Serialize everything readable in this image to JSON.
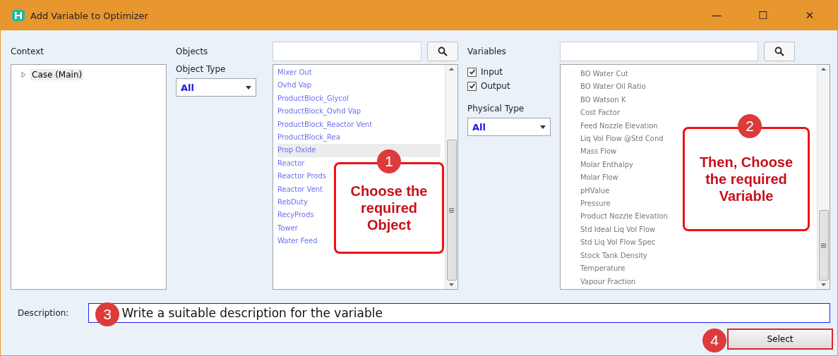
{
  "window": {
    "title": "Add Variable to Optimizer",
    "controls": [
      "—",
      "☐",
      "✕"
    ]
  },
  "context": {
    "label": "Context",
    "tree": [
      {
        "label": "Case (Main)",
        "expanded": false,
        "selected": true
      }
    ]
  },
  "objects": {
    "label": "Objects",
    "object_type": {
      "label": "Object Type",
      "value": "All"
    },
    "items": [
      {
        "label": "Mixer Out",
        "selected": false
      },
      {
        "label": "Ovhd Vap",
        "selected": false
      },
      {
        "label": "ProductBlock_Glycol",
        "selected": false
      },
      {
        "label": "ProductBlock_Ovhd Vap",
        "selected": false
      },
      {
        "label": "ProductBlock_Reactor Vent",
        "selected": false
      },
      {
        "label": "ProductBlock_Rea",
        "selected": false
      },
      {
        "label": "Prop Oxide",
        "selected": true
      },
      {
        "label": "Reactor",
        "selected": false
      },
      {
        "label": "Reactor Prods",
        "selected": false
      },
      {
        "label": "Reactor Vent",
        "selected": false
      },
      {
        "label": "RebDuty",
        "selected": false
      },
      {
        "label": "RecyProds",
        "selected": false
      },
      {
        "label": "Tower",
        "selected": false
      },
      {
        "label": "Water Feed",
        "selected": false
      }
    ]
  },
  "filters": {
    "checkboxes": [
      {
        "label": "Input",
        "checked": true
      },
      {
        "label": "Output",
        "checked": true
      }
    ],
    "physical_type": {
      "label": "Physical Type",
      "value": "All"
    }
  },
  "variables": {
    "label": "Variables",
    "items": [
      "BO Water Cut",
      "BO Water Oil Ratio",
      "BO Watson K",
      "Cost Factor",
      "Feed Nozzle Elevation",
      "Liq Vol Flow @Std Cond",
      "Mass Flow",
      "Molar Enthalpy",
      "Molar Flow",
      "pHValue",
      "Pressure",
      "Product Nozzle Elevation",
      "Std Ideal Liq Vol Flow",
      "Std Liq Vol Flow Spec",
      "Stock Tank Density",
      "Temperature",
      "Vapour Fraction"
    ]
  },
  "description": {
    "label": "Description:",
    "value": "Write a suitable description for the variable"
  },
  "select_button": "Select",
  "callouts": [
    {
      "number": "1",
      "text": "Choose the required Object"
    },
    {
      "number": "2",
      "text": "Then, Choose the required Variable"
    },
    {
      "number": "3"
    },
    {
      "number": "4"
    }
  ]
}
